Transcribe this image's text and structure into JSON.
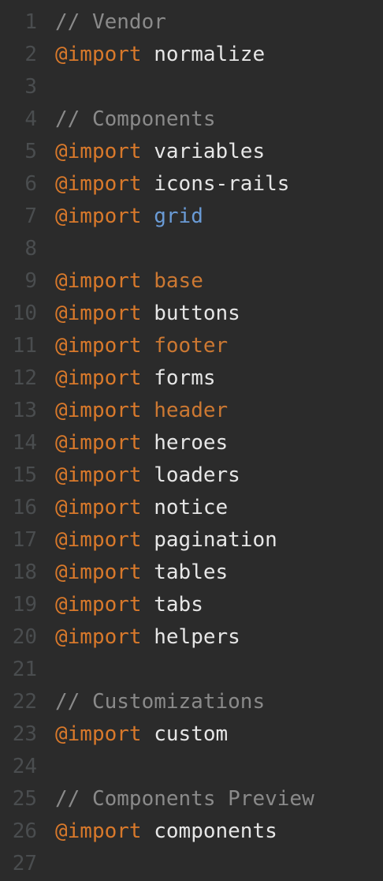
{
  "editor": {
    "lines": [
      {
        "num": "1",
        "kind": "comment",
        "text": "// Vendor"
      },
      {
        "num": "2",
        "kind": "import",
        "kw": "@import",
        "name": "normalize",
        "style": "plain"
      },
      {
        "num": "3",
        "kind": "blank"
      },
      {
        "num": "4",
        "kind": "comment",
        "text": "// Components"
      },
      {
        "num": "5",
        "kind": "import",
        "kw": "@import",
        "name": "variables",
        "style": "plain"
      },
      {
        "num": "6",
        "kind": "import",
        "kw": "@import",
        "name": "icons-rails",
        "style": "plain"
      },
      {
        "num": "7",
        "kind": "import",
        "kw": "@import",
        "name": "grid",
        "style": "blue"
      },
      {
        "num": "8",
        "kind": "blank"
      },
      {
        "num": "9",
        "kind": "import",
        "kw": "@import",
        "name": "base",
        "style": "ref"
      },
      {
        "num": "10",
        "kind": "import",
        "kw": "@import",
        "name": "buttons",
        "style": "plain"
      },
      {
        "num": "11",
        "kind": "import",
        "kw": "@import",
        "name": "footer",
        "style": "ref"
      },
      {
        "num": "12",
        "kind": "import",
        "kw": "@import",
        "name": "forms",
        "style": "plain"
      },
      {
        "num": "13",
        "kind": "import",
        "kw": "@import",
        "name": "header",
        "style": "ref"
      },
      {
        "num": "14",
        "kind": "import",
        "kw": "@import",
        "name": "heroes",
        "style": "plain"
      },
      {
        "num": "15",
        "kind": "import",
        "kw": "@import",
        "name": "loaders",
        "style": "plain"
      },
      {
        "num": "16",
        "kind": "import",
        "kw": "@import",
        "name": "notice",
        "style": "plain"
      },
      {
        "num": "17",
        "kind": "import",
        "kw": "@import",
        "name": "pagination",
        "style": "plain"
      },
      {
        "num": "18",
        "kind": "import",
        "kw": "@import",
        "name": "tables",
        "style": "plain"
      },
      {
        "num": "19",
        "kind": "import",
        "kw": "@import",
        "name": "tabs",
        "style": "plain"
      },
      {
        "num": "20",
        "kind": "import",
        "kw": "@import",
        "name": "helpers",
        "style": "plain"
      },
      {
        "num": "21",
        "kind": "blank"
      },
      {
        "num": "22",
        "kind": "comment",
        "text": "// Customizations"
      },
      {
        "num": "23",
        "kind": "import",
        "kw": "@import",
        "name": "custom",
        "style": "plain"
      },
      {
        "num": "24",
        "kind": "blank"
      },
      {
        "num": "25",
        "kind": "comment",
        "text": "// Components Preview"
      },
      {
        "num": "26",
        "kind": "import",
        "kw": "@import",
        "name": "components",
        "style": "plain"
      },
      {
        "num": "27",
        "kind": "blank"
      }
    ]
  }
}
